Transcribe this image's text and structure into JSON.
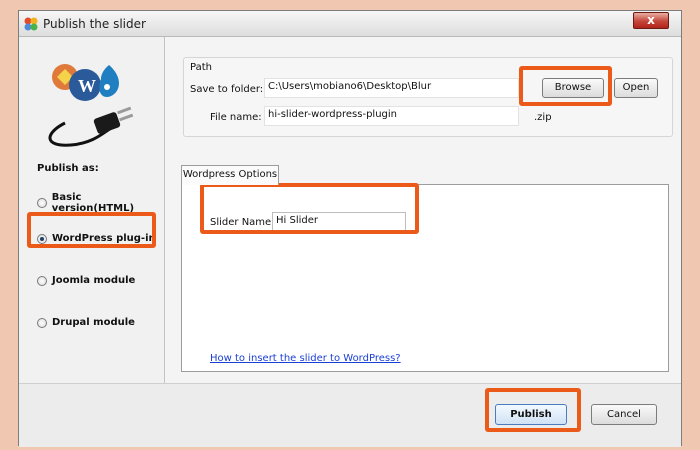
{
  "window": {
    "title": "Publish the slider",
    "close_glyph": "x"
  },
  "left_panel": {
    "publish_as_label": "Publish as:",
    "options": [
      {
        "label": "Basic version(HTML)",
        "checked": false
      },
      {
        "label": "WordPress plug-in",
        "checked": true
      },
      {
        "label": "Joomla module",
        "checked": false
      },
      {
        "label": "Drupal module",
        "checked": false
      }
    ]
  },
  "path_group": {
    "title": "Path",
    "save_label": "Save to folder:",
    "folder_value": "C:\\Users\\mobiano6\\Desktop\\Blur",
    "browse_label": "Browse",
    "open_label": "Open",
    "file_label": "File name:",
    "file_value": "hi-slider-wordpress-plugin",
    "file_ext": ".zip"
  },
  "options_tab": {
    "tab_label": "Wordpress Options",
    "slider_name_label": "Slider Name:",
    "slider_name_value": "Hi Slider",
    "help_link": "How to insert the slider to WordPress?"
  },
  "footer": {
    "publish_label": "Publish",
    "cancel_label": "Cancel"
  },
  "colors": {
    "highlight": "#ec5a1a",
    "page_background": "#f0c8b2",
    "link": "#1a3fd6"
  },
  "icons": [
    "app-icon",
    "close-icon",
    "cms-plug-logo",
    "radio-button"
  ]
}
